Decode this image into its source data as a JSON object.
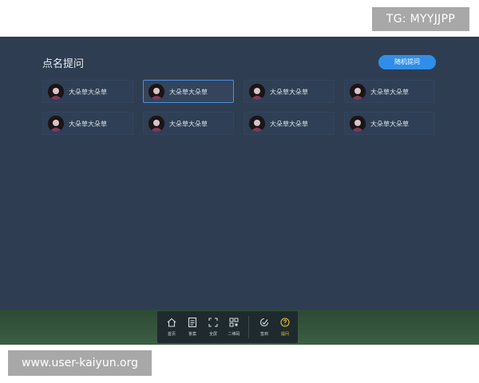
{
  "watermark_top": "TG: MYYJJPP",
  "watermark_bottom": "www.user-kaiyun.org",
  "panel": {
    "title": "点名提问",
    "random_button": "随机提问"
  },
  "students": [
    {
      "name": "大朵草大朵草",
      "selected": false
    },
    {
      "name": "大朵草大朵草",
      "selected": true
    },
    {
      "name": "大朵草大朵草",
      "selected": false
    },
    {
      "name": "大朵草大朵草",
      "selected": false
    },
    {
      "name": "大朵草大朵草",
      "selected": false
    },
    {
      "name": "大朵草大朵草",
      "selected": false
    },
    {
      "name": "大朵草大朵草",
      "selected": false
    },
    {
      "name": "大朵草大朵草",
      "selected": false
    }
  ],
  "toolbar": [
    {
      "label": "首页",
      "icon": "home-icon"
    },
    {
      "label": "答案",
      "icon": "document-icon"
    },
    {
      "label": "全屏",
      "icon": "fullscreen-icon"
    },
    {
      "label": "二维码",
      "icon": "qr-code-icon"
    },
    {
      "label": "签到",
      "icon": "check-in-icon"
    },
    {
      "label": "提问",
      "icon": "help-icon"
    }
  ],
  "colors": {
    "panel_bg": "#2e3d52",
    "accent": "#2f8fe8",
    "selected_border": "#4b8fe0",
    "help_icon": "#e2c23a"
  }
}
